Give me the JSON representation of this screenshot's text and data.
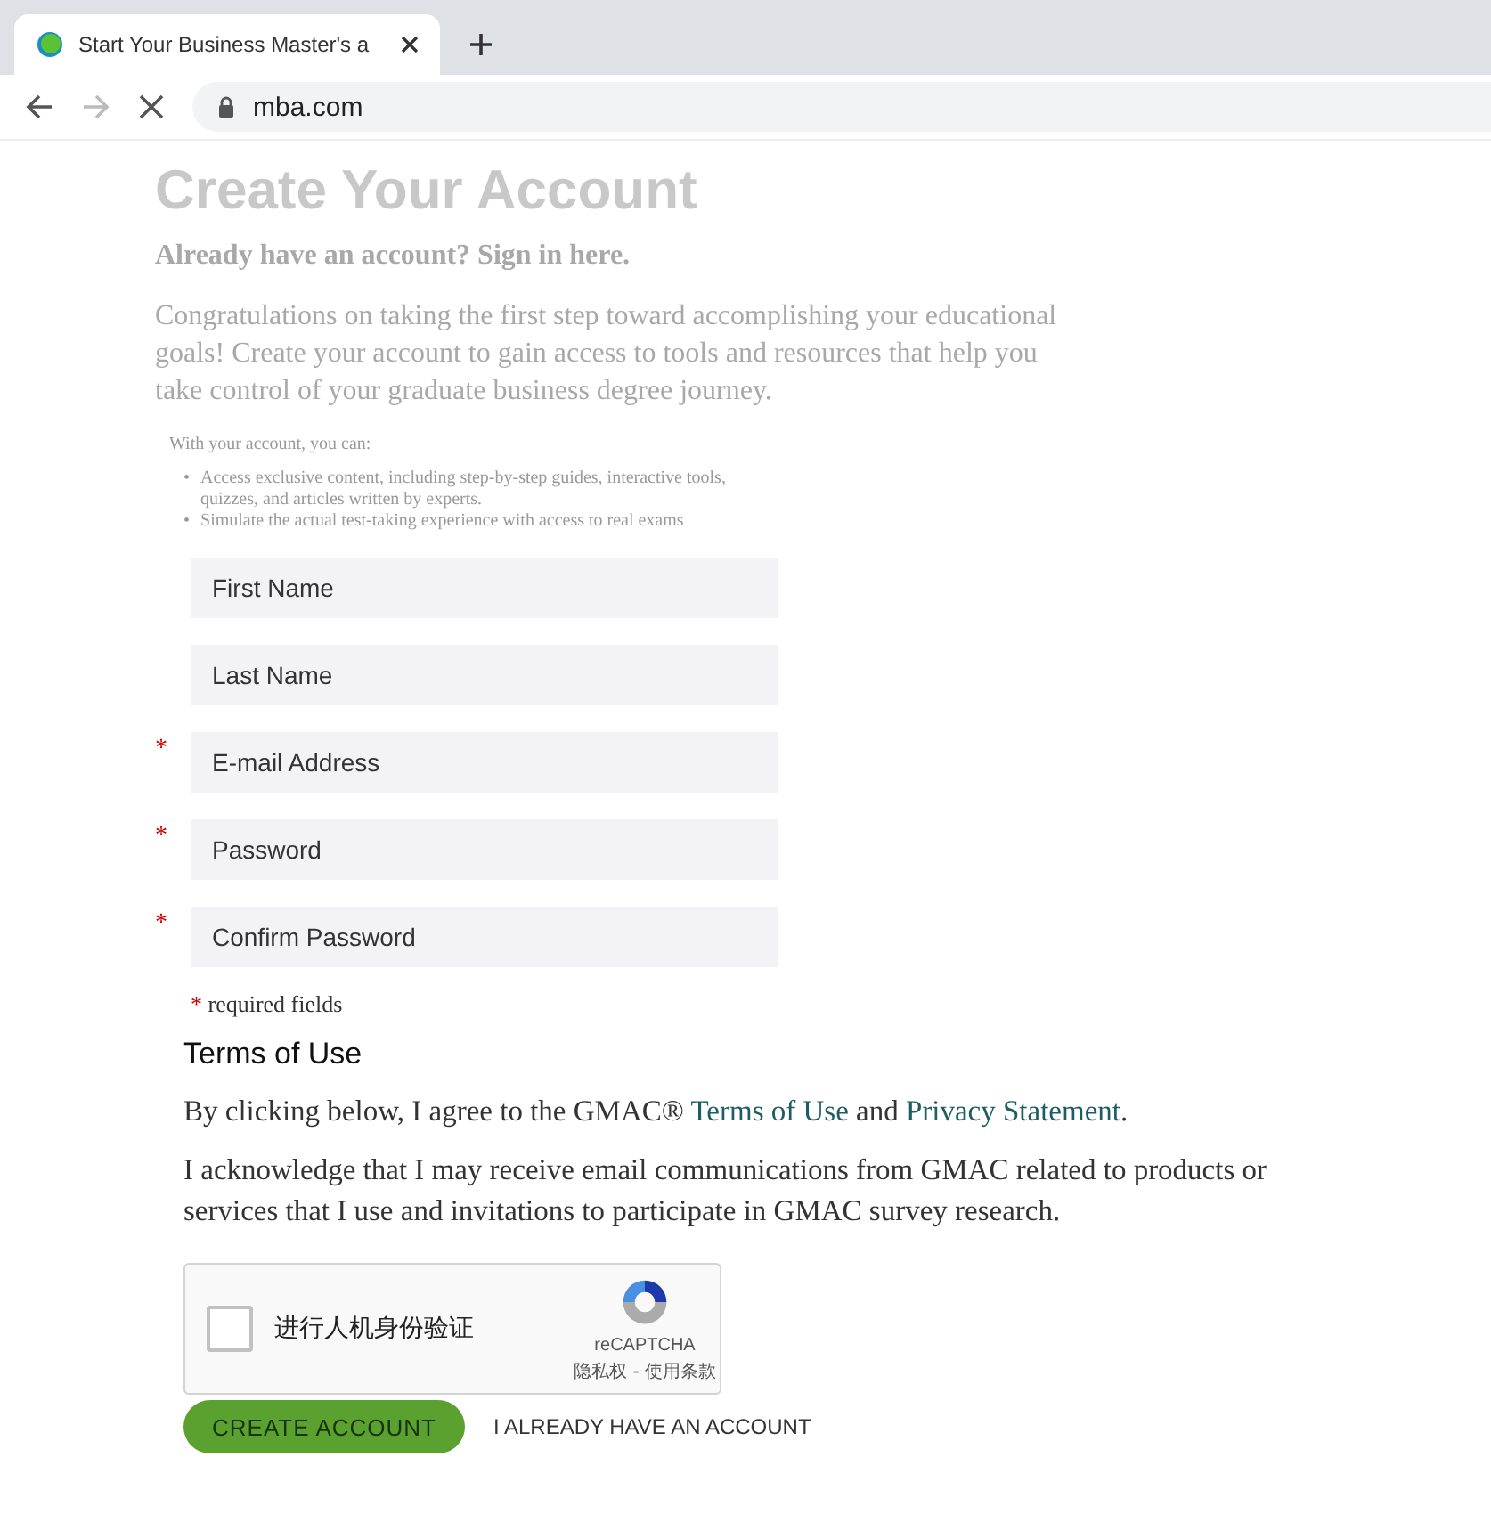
{
  "browser": {
    "tab_title": "Start Your Business Master's a",
    "url": "mba.com"
  },
  "page": {
    "title": "Create Your Account",
    "signin_prompt": "Already have an account? Sign in here.",
    "intro": "Congratulations on taking the first step toward accomplishing your educational goals! Create your account to gain access to tools and resources that help you take control of your graduate business degree journey.",
    "benefits_heading": "With your account, you can:",
    "bullet": "•",
    "benefits": [
      "Access exclusive content, including step-by-step guides, interactive tools, quizzes, and articles written by experts.",
      "Simulate the actual test-taking experience with access to real exams"
    ]
  },
  "form": {
    "fields": [
      {
        "placeholder": "First Name",
        "required": false
      },
      {
        "placeholder": "Last Name",
        "required": false
      },
      {
        "placeholder": "E-mail Address",
        "required": true
      },
      {
        "placeholder": "Password",
        "required": true
      },
      {
        "placeholder": "Confirm Password",
        "required": true
      }
    ],
    "required_mark": "*",
    "required_note": "required fields"
  },
  "terms": {
    "heading": "Terms of Use",
    "agree_before": "By clicking below, I agree to the GMAC® ",
    "terms_link": "Terms of Use",
    "agree_middle": " and ",
    "privacy_link": "Privacy Statement",
    "agree_after": ".",
    "acknowledge": "I acknowledge that I may receive email communications from GMAC related to products or services that I use and invitations to participate in GMAC survey research."
  },
  "captcha": {
    "checked": false,
    "label": "进行人机身份验证",
    "brand": "reCAPTCHA",
    "privacy": "隐私权",
    "separator": " - ",
    "terms": "使用条款"
  },
  "buttons": {
    "create": "CREATE ACCOUNT",
    "existing": "I ALREADY HAVE AN ACCOUNT"
  }
}
